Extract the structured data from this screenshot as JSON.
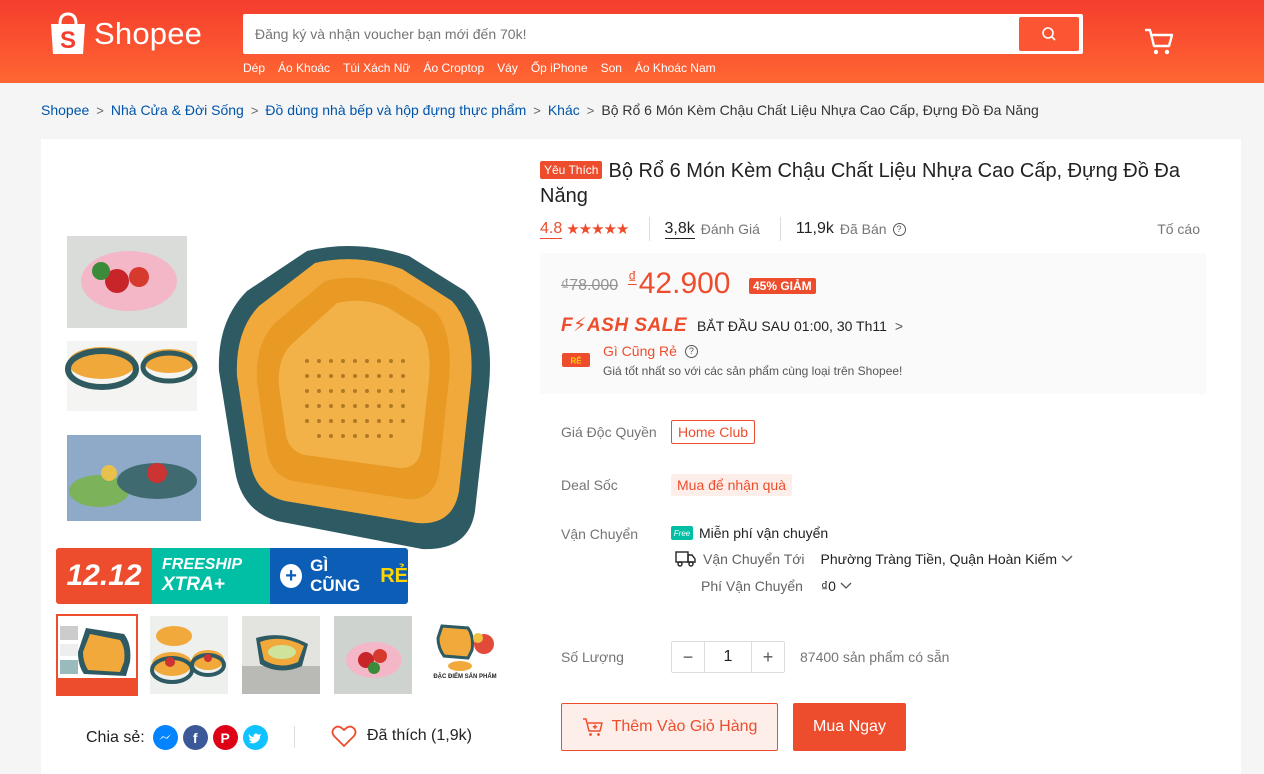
{
  "header": {
    "logo_text": "Shopee",
    "search_placeholder": "Đăng ký và nhận voucher bạn mới đến 70k!",
    "keywords": [
      "Dép",
      "Áo Khoác",
      "Túi Xách Nữ",
      "Áo Croptop",
      "Váy",
      "Ốp iPhone",
      "Son",
      "Áo Khoác Nam"
    ]
  },
  "breadcrumb": {
    "items": [
      "Shopee",
      "Nhà Cửa & Đời Sống",
      "Đồ dùng nhà bếp và hộp đựng thực phẩm",
      "Khác"
    ],
    "current": "Bộ Rổ 6 Món Kèm Chậu Chất Liệu Nhựa Cao Cấp, Đựng Đồ Đa Năng"
  },
  "gallery": {
    "banner": {
      "date": "12.12",
      "freeship": "FREESHIP",
      "xtra": "XTRA+",
      "cheap": "GÌ CŨNG",
      "re": "RẺ"
    },
    "thumb5_caption": "ĐẶC ĐIỂM SẢN PHẨM"
  },
  "share": {
    "label": "Chia sẻ:",
    "liked": "Đã thích (1,9k)"
  },
  "product": {
    "badge": "Yêu Thích",
    "title": "Bộ Rổ 6 Món Kèm Chậu Chất Liệu Nhựa Cao Cấp, Đựng Đồ Đa Năng",
    "rating": "4.8",
    "stars": "★★★★★",
    "review_count": "3,8k",
    "review_label": "Đánh Giá",
    "sold_count": "11,9k",
    "sold_label": "Đã Bán",
    "report": "Tố cáo"
  },
  "price": {
    "old": "₫78.000",
    "currency": "₫",
    "new": "42.900",
    "discount": "45% GIẢM",
    "flash_logo": "F⚡ASH SALE",
    "flash_time": "BẮT ĐẦU SAU 01:00, 30 Th11",
    "cheap_title": "Gì Cũng Rẻ",
    "cheap_sub": "Giá tốt nhất so với các sản phẩm cùng loại trên Shopee!"
  },
  "details": {
    "exclusive_label": "Giá Độc Quyền",
    "exclusive_value": "Home Club",
    "deal_label": "Deal Sốc",
    "deal_value": "Mua để nhận quà",
    "shipping_label": "Vận Chuyển",
    "free_ship": "Miễn phí vận chuyển",
    "free_icon": "Free",
    "ship_to_label": "Vận Chuyển Tới",
    "ship_to_value": "Phường Tràng Tiền, Quận Hoàn Kiếm",
    "ship_fee_label": "Phí Vận Chuyển",
    "ship_fee_value": "₫0",
    "qty_label": "Số Lượng",
    "qty_value": "1",
    "minus": "−",
    "plus": "+",
    "stock": "87400 sản phẩm có sẵn"
  },
  "actions": {
    "add_to_cart": "Thêm Vào Giỏ Hàng",
    "buy_now": "Mua Ngay"
  },
  "colors": {
    "brand": "#ee4d2d",
    "teal": "#00bfa5",
    "blue": "#0b5db6"
  }
}
